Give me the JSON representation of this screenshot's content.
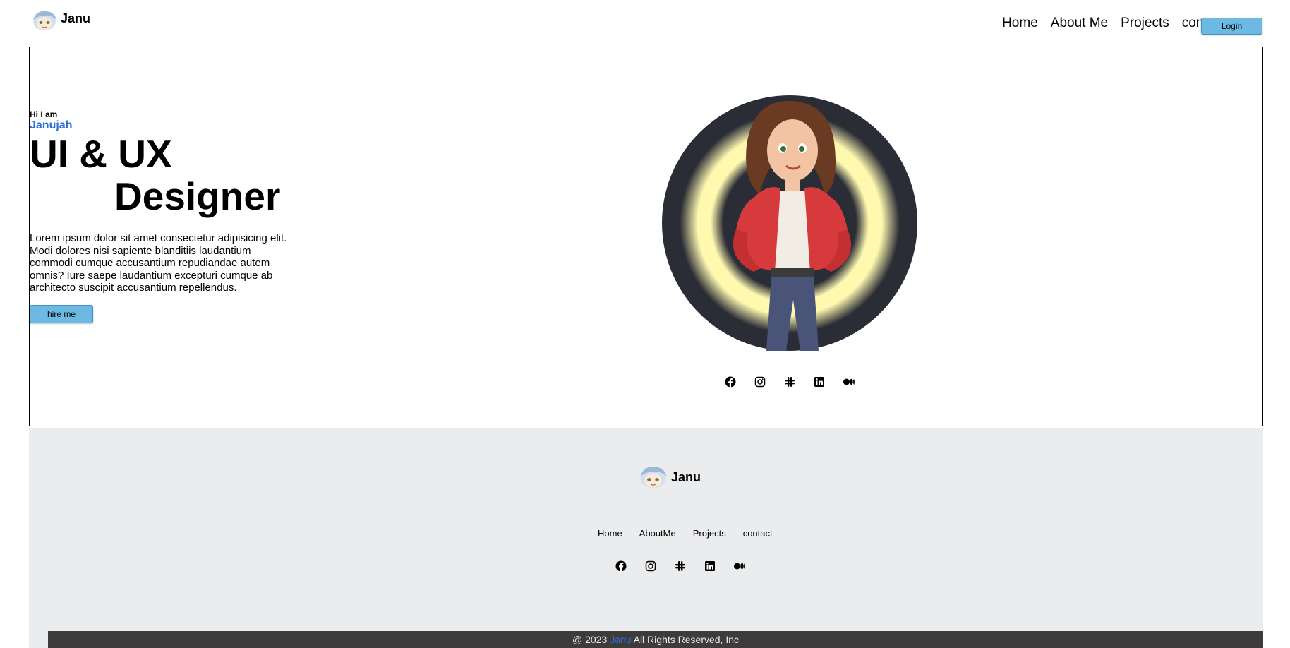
{
  "header": {
    "logo_text": "Janu",
    "nav": [
      "Home",
      "About Me",
      "Projects",
      "contact"
    ],
    "login_label": "Login"
  },
  "hero": {
    "greeting": "Hi I am",
    "name": "Janujah",
    "role_line1": "UI & UX",
    "role_line2": "Designer",
    "description": "Lorem ipsum dolor sit amet consectetur adipisicing elit. Modi dolores nisi sapiente blanditiis laudantium commodi cumque accusantium repudiandae autem omnis? Iure saepe laudantium excepturi cumque ab architecto suscipit accusantium repellendus.",
    "hire_label": "hire me",
    "socials": [
      "facebook-icon",
      "instagram-icon",
      "slack-icon",
      "linkedin-icon",
      "medium-icon"
    ]
  },
  "footer": {
    "logo_text": "Janu",
    "nav": [
      "Home",
      "AboutMe",
      "Projects",
      "contact"
    ],
    "copyright_prefix": "@ 2023",
    "copyright_brand": "Janu",
    "copyright_suffix": "All Rights Reserved, Inc"
  },
  "colors": {
    "accent": "#2a6fd6",
    "button": "#6cb9e4",
    "footer_bg": "#ebecee",
    "copyright_bg": "#3d3b3c",
    "portrait_bg": "#2b2d36",
    "glow": "#fff9b0"
  }
}
